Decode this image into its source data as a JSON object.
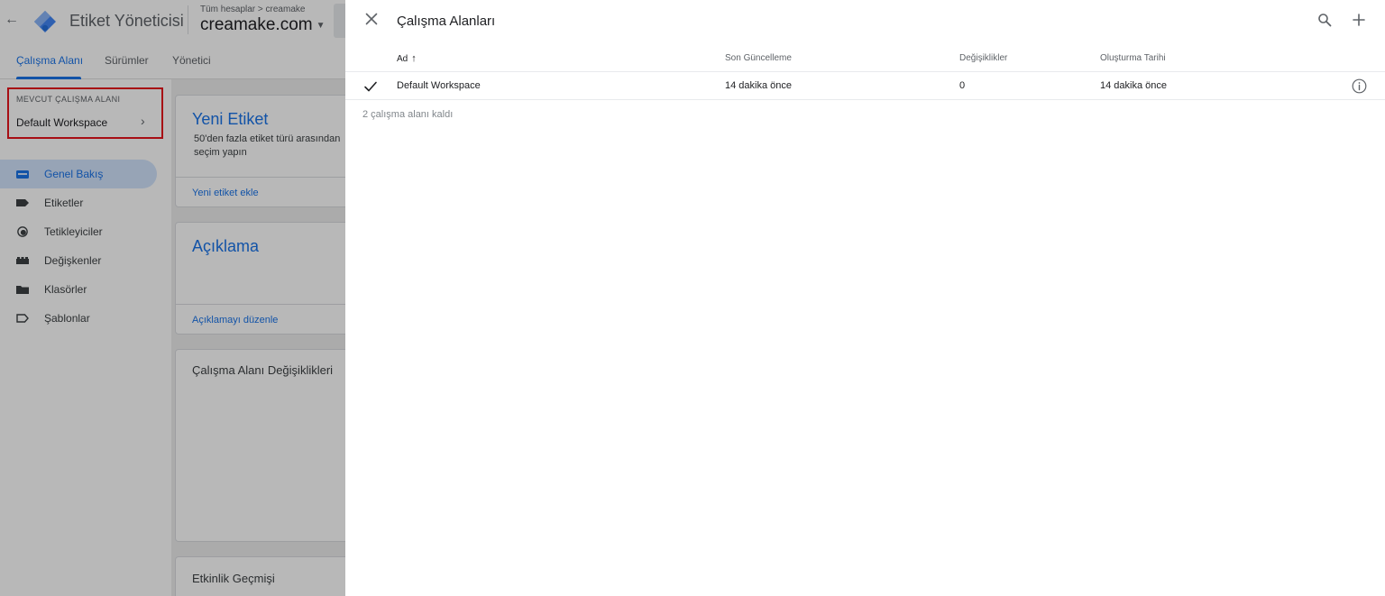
{
  "app": {
    "product_name": "Etiket Yöneticisi",
    "account_breadcrumb": "Tüm hesaplar > creamake",
    "container_name": "creamake.com",
    "tabs": [
      {
        "label": "Çalışma Alanı",
        "active": true
      },
      {
        "label": "Sürümler",
        "active": false
      },
      {
        "label": "Yönetici",
        "active": false
      }
    ],
    "current_workspace": {
      "label": "MEVCUT ÇALIŞMA ALANI",
      "name": "Default Workspace"
    },
    "nav": [
      {
        "label": "Genel Bakış",
        "icon": "overview-icon",
        "active": true
      },
      {
        "label": "Etiketler",
        "icon": "tag-icon",
        "active": false
      },
      {
        "label": "Tetikleyiciler",
        "icon": "trigger-icon",
        "active": false
      },
      {
        "label": "Değişkenler",
        "icon": "variable-icon",
        "active": false
      },
      {
        "label": "Klasörler",
        "icon": "folder-icon",
        "active": false
      },
      {
        "label": "Şablonlar",
        "icon": "template-icon",
        "active": false
      }
    ],
    "cards": {
      "new_tag": {
        "title": "Yeni Etiket",
        "description": "50'den fazla etiket türü arasından seçim yapın",
        "link": "Yeni etiket ekle"
      },
      "description": {
        "title": "Açıklama",
        "link": "Açıklamayı düzenle"
      },
      "changes": {
        "title": "Çalışma Alanı Değişiklikleri"
      },
      "history": {
        "title": "Etkinlik Geçmişi"
      }
    }
  },
  "panel": {
    "title": "Çalışma Alanları",
    "columns": {
      "name": "Ad",
      "last_updated": "Son Güncelleme",
      "changes": "Değişiklikler",
      "created": "Oluşturma Tarihi"
    },
    "rows": [
      {
        "name": "Default Workspace",
        "last_updated": "14 dakika önce",
        "changes": "0",
        "created": "14 dakika önce",
        "selected": true
      }
    ],
    "remaining_text": "2 çalışma alanı kaldı"
  },
  "colors": {
    "accent": "#1a73e8",
    "highlight_box": "#e8141c",
    "active_nav_bg": "#d2e3fc"
  }
}
